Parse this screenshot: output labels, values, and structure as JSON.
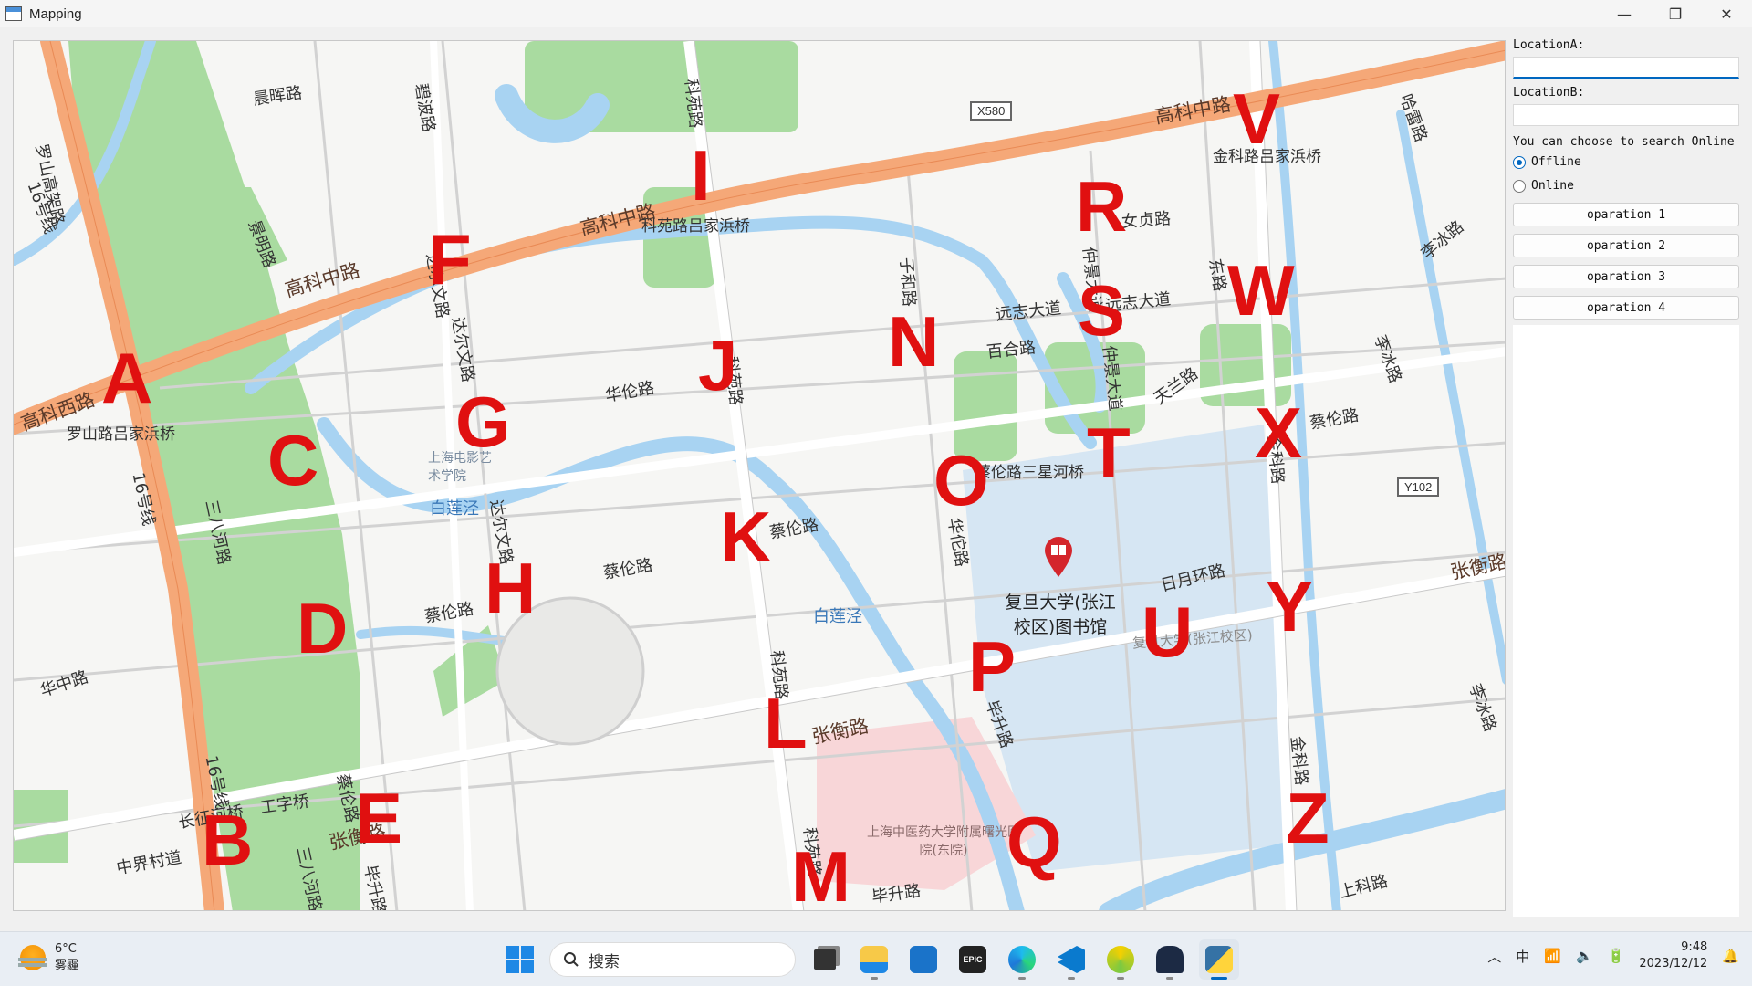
{
  "window": {
    "title": "Mapping",
    "controls": {
      "minimize": "—",
      "maximize": "❐",
      "close": "✕"
    }
  },
  "side": {
    "location_a_label": "LocationA:",
    "location_a_value": "",
    "location_b_label": "LocationB:",
    "location_b_value": "",
    "search_hint": "You can choose to search Online",
    "mode_options": [
      {
        "label": "Offline",
        "selected": true
      },
      {
        "label": "Online",
        "selected": false
      }
    ],
    "buttons": [
      "oparation 1",
      "oparation 2",
      "oparation 3",
      "oparation 4"
    ]
  },
  "map": {
    "markers": [
      "A",
      "B",
      "C",
      "D",
      "E",
      "F",
      "G",
      "H",
      "I",
      "J",
      "K",
      "L",
      "M",
      "N",
      "O",
      "P",
      "Q",
      "R",
      "S",
      "T",
      "U",
      "V",
      "W",
      "X",
      "Y",
      "Z"
    ],
    "roads": {
      "gaoke_middle": "高科中路",
      "gaoke_west": "高科西路",
      "gaoke_mid_top": "高科中路",
      "luoshan_viaduct": "罗山高架路",
      "line16": "16号线",
      "line16_b": "16号线",
      "line16_c": "16号线",
      "sanba_river": "三八河路",
      "sanba_river_b": "三八河路",
      "huazhong": "华中路",
      "zhongjie_road": "中界村道",
      "changzheng": "长征河桥",
      "gongzi_bridge": "工字桥",
      "zhangheng": "张衡路",
      "zhangheng_b": "张衡路",
      "zhangheng_c": "张衡路",
      "cailun": "蔡伦路",
      "cailun_b": "蔡伦路",
      "cailun_c": "蔡伦路",
      "cailun_d": "蔡伦路",
      "cailun_e": "蔡伦路",
      "hualun": "华伦路",
      "dalwen": "达尔文路",
      "dalwen_b": "达尔文路",
      "dalwen_c": "达尔文路",
      "keyuan": "科苑路",
      "keyuan_b": "科苑路",
      "keyuan_c": "科苑路",
      "keyuan_d": "科苑路",
      "bailianjing": "白莲泾",
      "bailianjing_b": "白莲泾",
      "chenhui": "晨晖路",
      "biboroad": "碧波路",
      "jingming": "景明路",
      "yuanzhi": "远志大道",
      "yuanzhi_b": "远志大道",
      "baihe": "百合路",
      "zhongjing": "仲景大道",
      "zhongjing_b": "仲景大道",
      "tianlan": "天兰路",
      "nvzhen": "女贞路",
      "jinke": "金科路",
      "jinke_b": "金科路",
      "jinke_c": "金科路",
      "lihua": "哈雷路",
      "libing": "李冰路",
      "libing_b": "李冰路",
      "libing_c": "李冰路",
      "zizhi": "子和路",
      "huatuo": "华佗路",
      "bisheng": "毕升路",
      "bisheng_b": "毕升路",
      "bisheng_c": "毕升路",
      "riyue": "日月环路",
      "shangke": "上科路",
      "dong_road": "东路"
    },
    "pois": {
      "luoshan_bridge": "罗山路吕家浜桥",
      "keyuan_bridge": "科苑路吕家浜桥",
      "jinke_bridge": "金科路吕家浜桥",
      "sanxing_bridge": "蔡伦路三星河桥",
      "film_academy": "上海电影艺术学院",
      "fudan_library": "复旦大学(张江校区)图书馆",
      "fudan_campus": "复旦大学(张江校区)",
      "hospital": "上海中医药大学附属曙光医院(东院)"
    },
    "shields": {
      "x580": "X580",
      "y102": "Y102"
    }
  },
  "taskbar": {
    "weather_temp": "6°C",
    "weather_desc": "雾霾",
    "search_placeholder": "搜索",
    "apps": [
      "task-view",
      "file-explorer",
      "microsoft-store",
      "epic-games",
      "edge",
      "vscode",
      "browser-yellow",
      "game-app",
      "python-app"
    ],
    "ime": "中",
    "time": "9:48",
    "date": "2023/12/12"
  },
  "colors": {
    "accent": "#0067c0",
    "marker_red": "#e01010",
    "highway_orange": "#f5a878",
    "river_blue": "#a8d3f2",
    "park_green": "#a9dba0",
    "campus_blue": "#d6e6f3",
    "hospital_pink": "#f8d6d8"
  }
}
